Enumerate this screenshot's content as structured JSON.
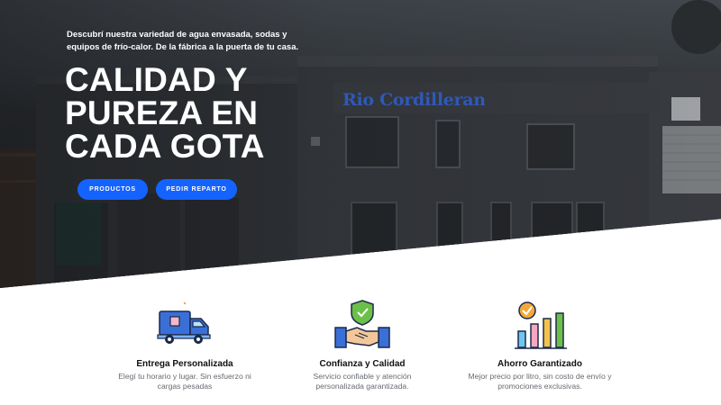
{
  "hero": {
    "tagline": "Descubrí nuestra variedad de agua envasada, sodas y equipos de frío-calor. De la fábrica a la puerta de tu casa.",
    "headline": "CALIDAD Y\nPUREZA EN\nCADA GOTA",
    "building_sign": "Rio Cordillerano",
    "buttons": {
      "products": "PRODUCTOS",
      "delivery": "PEDIR REPARTO"
    },
    "accent_color": "#1463ff"
  },
  "features": [
    {
      "icon": "delivery-truck-icon",
      "title": "Entrega Personalizada",
      "description": "Elegí tu horario y lugar. Sin esfuerzo ni cargas pesadas"
    },
    {
      "icon": "handshake-shield-icon",
      "title": "Confianza y Calidad",
      "description": "Servicio confiable y atención personalizada garantizada."
    },
    {
      "icon": "savings-chart-icon",
      "title": "Ahorro Garantizado",
      "description": "Mejor precio por litro, sin costo de envío y promociones exclusivas."
    }
  ]
}
